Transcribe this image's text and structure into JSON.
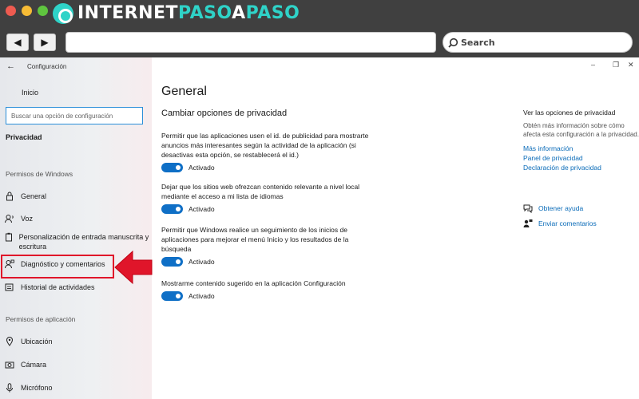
{
  "browser": {
    "logo_part1": "INTERNET",
    "logo_part2": "PASO",
    "logo_part3": "A",
    "logo_part4": "PASO",
    "back_glyph": "◀",
    "forward_glyph": "▶",
    "search_label": "Search"
  },
  "window": {
    "title": "Configuración",
    "back_glyph": "←",
    "minimize_glyph": "–",
    "maximize_glyph": "❐",
    "close_glyph": "✕"
  },
  "sidebar": {
    "home": "Inicio",
    "search_placeholder": "Buscar una opción de configuración",
    "section": "Privacidad",
    "group_windows": "Permisos de Windows",
    "group_app": "Permisos de aplicación",
    "items": {
      "general": "General",
      "voz": "Voz",
      "escritura": "Personalización de entrada manuscrita y escritura",
      "diagnostico": "Diagnóstico y comentarios",
      "historial": "Historial de actividades",
      "ubicacion": "Ubicación",
      "camara": "Cámara",
      "microfono": "Micrófono"
    }
  },
  "main": {
    "title": "General",
    "subtitle": "Cambiar opciones de privacidad",
    "settings": [
      {
        "description": "Permitir que las aplicaciones usen el id. de publicidad para mostrarte anuncios más interesantes según la actividad de la aplicación (si desactivas esta opción, se restablecerá el id.)",
        "state": "Activado"
      },
      {
        "description": "Dejar que los sitios web ofrezcan contenido relevante a nivel local mediante el acceso a mi lista de idiomas",
        "state": "Activado"
      },
      {
        "description": "Permitir que Windows realice un seguimiento de los inicios de aplicaciones para mejorar el menú Inicio y los resultados de la búsqueda",
        "state": "Activado"
      },
      {
        "description": "Mostrarme contenido sugerido en la aplicación Configuración",
        "state": "Activado"
      }
    ]
  },
  "right_panel": {
    "title": "Ver las opciones de privacidad",
    "text": "Obtén más información sobre cómo afecta esta configuración a la privacidad.",
    "links": [
      "Más información",
      "Panel de privacidad",
      "Declaración de privacidad"
    ],
    "help": "Obtener ayuda",
    "feedback": "Enviar comentarios"
  },
  "colors": {
    "accent": "#0f6fc6",
    "highlight": "#e0152a",
    "link": "#0a6bb8",
    "brand": "#2fd3c8"
  }
}
